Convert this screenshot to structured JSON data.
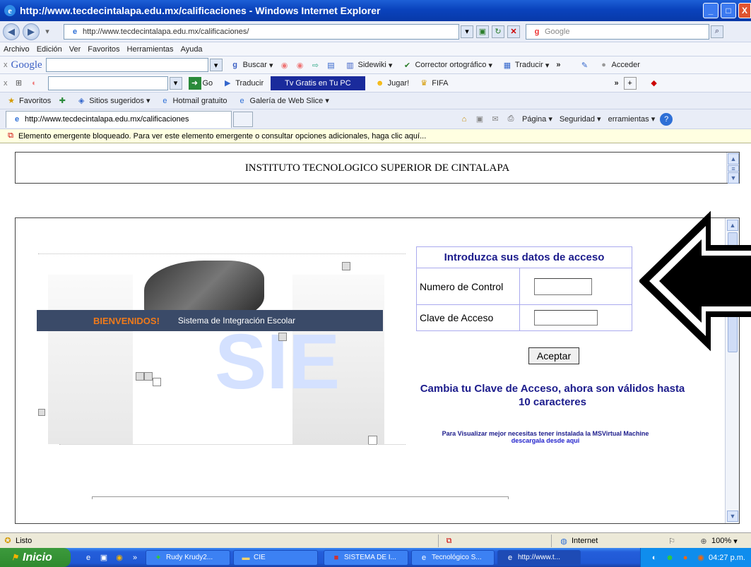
{
  "window": {
    "title": "http://www.tecdecintalapa.edu.mx/calificaciones - Windows Internet Explorer",
    "minimize_glyph": "_",
    "maximize_glyph": "□",
    "close_glyph": "X"
  },
  "address_bar": {
    "url": "http://www.tecdecintalapa.edu.mx/calificaciones/",
    "search_placeholder": "Google"
  },
  "menu": [
    "Archivo",
    "Edición",
    "Ver",
    "Favoritos",
    "Herramientas",
    "Ayuda"
  ],
  "google_toolbar": {
    "brand": "Google",
    "buscar": "Buscar",
    "sidewiki": "Sidewiki",
    "corrector": "Corrector ortográfico",
    "traducir": "Traducir",
    "more": "»",
    "acceder": "Acceder"
  },
  "second_toolbar": {
    "go": "Go",
    "traducir": "Traducir",
    "tv": "Tv Gratis en Tu PC",
    "jugar": "Jugar!",
    "fifa": "FIFA",
    "more": "»"
  },
  "favorites_bar": {
    "favoritos": "Favoritos",
    "items": [
      "Sitios sugeridos",
      "Hotmail gratuito",
      "Galería de Web Slice"
    ]
  },
  "tab": {
    "label": "http://www.tecdecintalapa.edu.mx/calificaciones"
  },
  "command_bar": {
    "pagina": "Página",
    "seguridad": "Seguridad",
    "herramientas": "erramientas"
  },
  "popup_bar": {
    "text": "Elemento emergente bloqueado. Para ver este elemento emergente o consultar opciones adicionales, haga clic aquí..."
  },
  "page": {
    "header_title": "INSTITUTO TECNOLOGICO SUPERIOR DE CINTALAPA",
    "banner": {
      "bienvenidos": "BIENVENIDOS!",
      "sistema": "Sistema de Integración Escolar",
      "logo": "SIE"
    },
    "login": {
      "heading": "Introduzca sus datos de acceso",
      "field1_label": "Numero de Control",
      "field2_label": "Clave de Acceso",
      "submit": "Aceptar"
    },
    "notice": "Cambia tu Clave de Acceso, ahora son válidos hasta 10 caracteres",
    "msvm_text": "Para Visualizar mejor necesitas tener instalada la MSVirtual Machine",
    "msvm_link": "descargala desde aqui"
  },
  "status_bar": {
    "left": "Listo",
    "zone": "Internet",
    "zoom": "100%"
  },
  "taskbar": {
    "start": "Inicio",
    "tasks": [
      "Rudy Krudy2...",
      "CIE",
      "SISTEMA DE I...",
      "Tecnológico S...",
      "http://www.t..."
    ],
    "clock": "04:27 p.m."
  },
  "colors": {
    "title_blue": "#0a43bd",
    "login_heading": "#1c1c8c",
    "notice": "#1c1c8c",
    "link": "#2222cc"
  }
}
